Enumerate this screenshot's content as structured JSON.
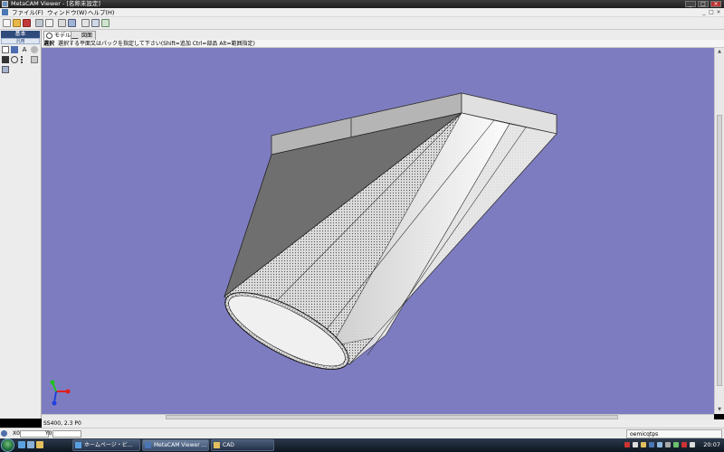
{
  "window": {
    "title": "MetaCAM Viewer - [名称未設定]",
    "controls": [
      "_",
      "□",
      "×"
    ]
  },
  "menu": {
    "items": [
      "ファイル(F)",
      "ウィンドウ(W)",
      "ヘルプ(H)"
    ],
    "right_controls": [
      "_",
      "□",
      "×"
    ]
  },
  "toolbar": {
    "icons": [
      "new-file-icon",
      "open-file-icon",
      "save-icon",
      "print-icon",
      "print-preview-icon",
      "copy-icon",
      "measure-icon",
      "section-icon",
      "select-icon"
    ]
  },
  "left_panel": {
    "header": "基本",
    "subheader": "汎用",
    "tools": [
      "pointer-icon",
      "rotate-icon",
      "text-icon",
      "settings-icon",
      "view-icon",
      "zoom-icon",
      "list-icon",
      "layer-icon",
      "layers-stack-icon"
    ]
  },
  "tabs": [
    {
      "label": "モデル",
      "icon": "model-icon",
      "active": true
    },
    {
      "label": "図面",
      "icon": "drawing-icon",
      "active": false
    }
  ],
  "instruction": {
    "label": "選択",
    "message": "選択する平面又はパックを指定して下さい(Shift=追加 Ctrl=部品 Alt=範囲指定)"
  },
  "viewport": {
    "background": "#7e7cc0",
    "model_fill_light": "#d8d8d8",
    "model_fill_dark": "#6f6f6f",
    "axis_colors": {
      "x": "#e02020",
      "y": "#20c020",
      "z": "#2040e0"
    }
  },
  "status": {
    "text": "SS400, 2.3 P0"
  },
  "coords": {
    "x_label": "X0",
    "y_label": "Y0",
    "user": "oemicqtps"
  },
  "taskbar": {
    "tasks": [
      {
        "label": "ホームページ・ビ...",
        "active": false
      },
      {
        "label": "MetaCAM Viewer ...",
        "active": true
      },
      {
        "label": "CAD",
        "active": false
      }
    ],
    "clock": "20:07"
  }
}
